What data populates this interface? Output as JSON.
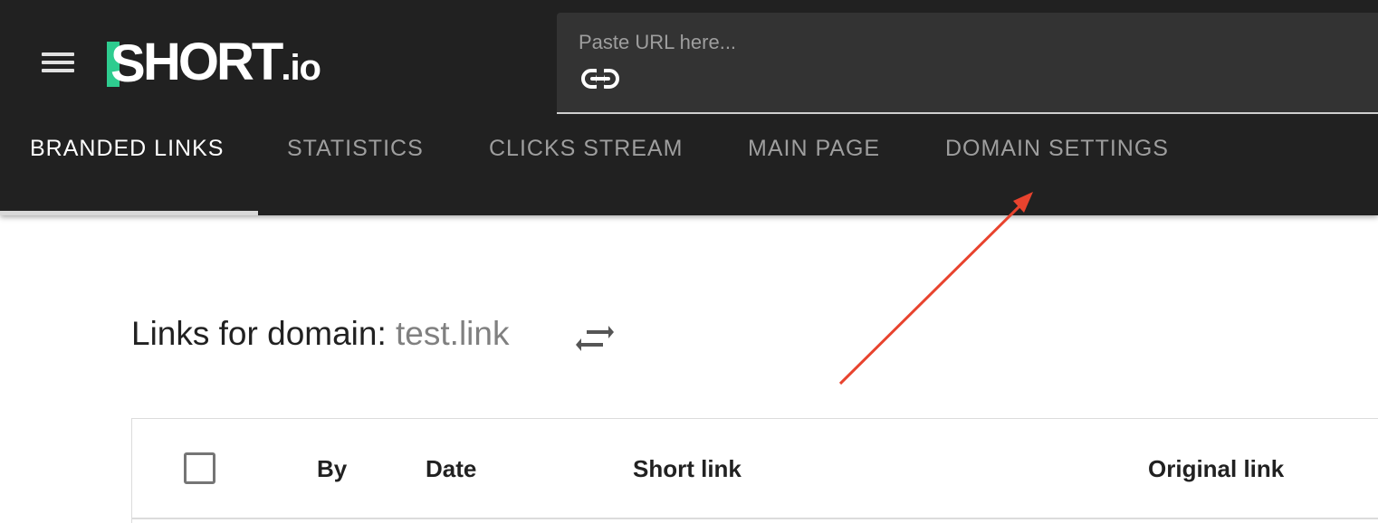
{
  "header": {
    "logo": {
      "text_main": "SHORT",
      "text_suffix": ".io",
      "accent_color": "#2ecc8f"
    },
    "menu_icon": "hamburger-menu-icon",
    "url_input": {
      "placeholder": "Paste URL here...",
      "value": "",
      "icon": "link-icon"
    }
  },
  "tabs": [
    {
      "label": "BRANDED LINKS",
      "active": true
    },
    {
      "label": "STATISTICS",
      "active": false
    },
    {
      "label": "CLICKS STREAM",
      "active": false
    },
    {
      "label": "MAIN PAGE",
      "active": false
    },
    {
      "label": "DOMAIN SETTINGS",
      "active": false
    }
  ],
  "main": {
    "heading_prefix": "Links for domain:",
    "domain": "test.link",
    "swap_icon": "swap-arrows-icon"
  },
  "table": {
    "columns": [
      "By",
      "Date",
      "Short link",
      "Original link"
    ]
  },
  "annotation": {
    "color": "#e8432e",
    "points_to": "DOMAIN SETTINGS"
  }
}
